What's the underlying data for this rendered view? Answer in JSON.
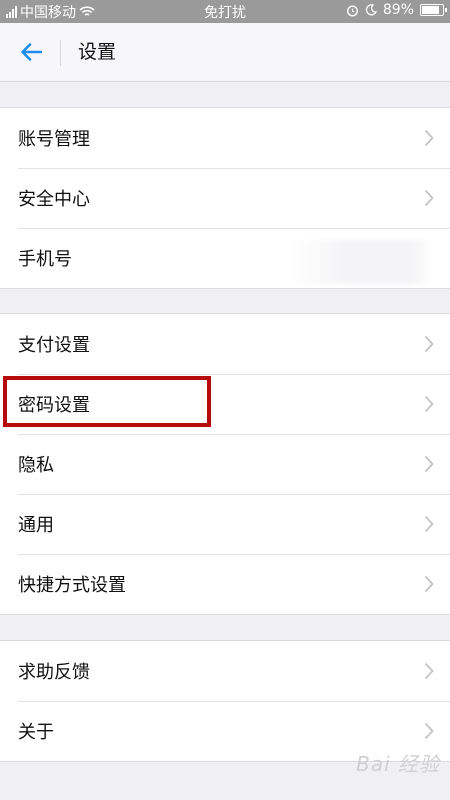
{
  "status_bar": {
    "carrier": "中国移动",
    "mode": "免打扰",
    "battery": "89%",
    "battery_level": 0.89,
    "icons": [
      "signal-icon",
      "wifi-icon",
      "alarm-icon",
      "moon-icon",
      "battery-icon"
    ]
  },
  "nav": {
    "title": "设置",
    "back_icon": "arrow-left-icon",
    "accent": "#1a8cf0"
  },
  "groups": [
    {
      "items": [
        {
          "label": "账号管理"
        },
        {
          "label": "安全中心"
        },
        {
          "label": "手机号"
        }
      ]
    },
    {
      "items": [
        {
          "label": "支付设置"
        },
        {
          "label": "密码设置"
        },
        {
          "label": "隐私"
        },
        {
          "label": "通用"
        },
        {
          "label": "快捷方式设置"
        }
      ]
    },
    {
      "items": [
        {
          "label": "求助反馈"
        },
        {
          "label": "关于"
        }
      ]
    }
  ],
  "highlight_color": "#b70b0b",
  "watermark": "Bai 经验"
}
